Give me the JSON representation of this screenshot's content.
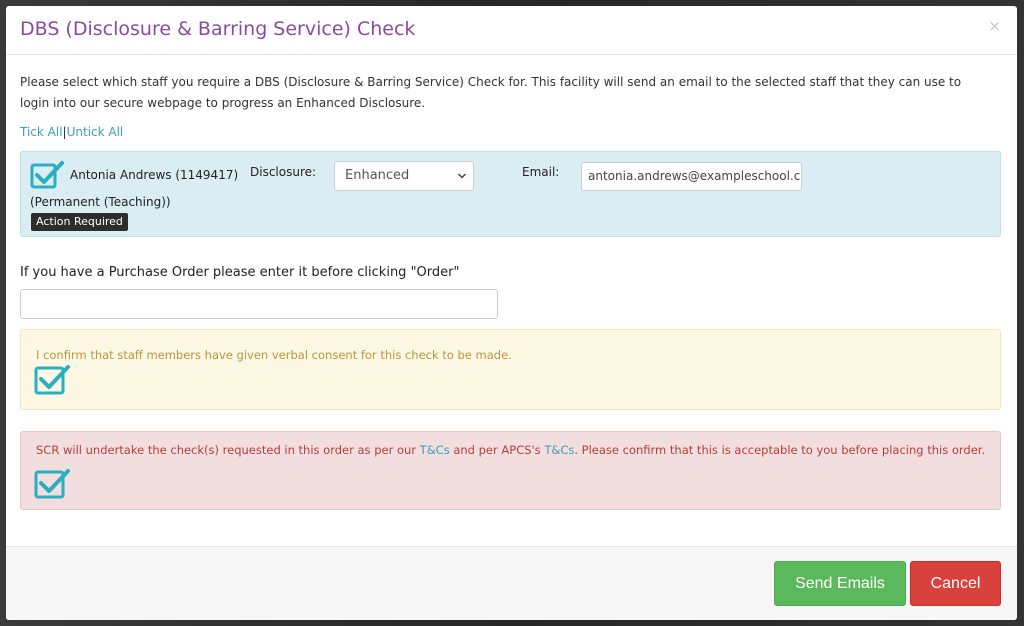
{
  "modal": {
    "title": "DBS (Disclosure & Barring Service) Check",
    "close_symbol": "×",
    "intro": "Please select which staff you require a DBS (Disclosure & Barring Service) Check for. This facility will send an email to the selected staff that they can use to login into our secure webpage to progress an Enhanced Disclosure."
  },
  "tick_links": {
    "tick_all": "Tick All",
    "separator": "|",
    "untick_all": "Untick All"
  },
  "staff": {
    "checked": true,
    "name": "Antonia Andrews (1149417)",
    "role": "(Permanent (Teaching))",
    "badge": "Action Required",
    "disclosure_label": "Disclosure:",
    "disclosure_value": "Enhanced",
    "email_label": "Email:",
    "email_value": "antonia.andrews@exampleschool.c"
  },
  "purchase_order": {
    "label": "If you have a Purchase Order please enter it before clicking \"Order\"",
    "value": ""
  },
  "consent": {
    "text": "I confirm that staff members have given verbal consent for this check to be made.",
    "checked": true
  },
  "terms": {
    "text_before": "SCR will undertake the check(s) requested in this order as per our ",
    "link1": "T&Cs",
    "text_middle": " and per APCS's ",
    "link2": "T&Cs",
    "text_after": ". Please confirm that this is acceptable to you before placing this order.",
    "checked": true
  },
  "footer": {
    "send_label": "Send Emails",
    "cancel_label": "Cancel"
  },
  "colors": {
    "title": "#8a4b9e",
    "checkbox": "#2aaec0",
    "send": "#5cb85c",
    "cancel": "#d9413d",
    "link": "#3b9fb8"
  },
  "icons": {
    "checkbox": "checkbox-checked-icon",
    "select_arrow": "chevron-down-icon",
    "close": "close-icon"
  }
}
